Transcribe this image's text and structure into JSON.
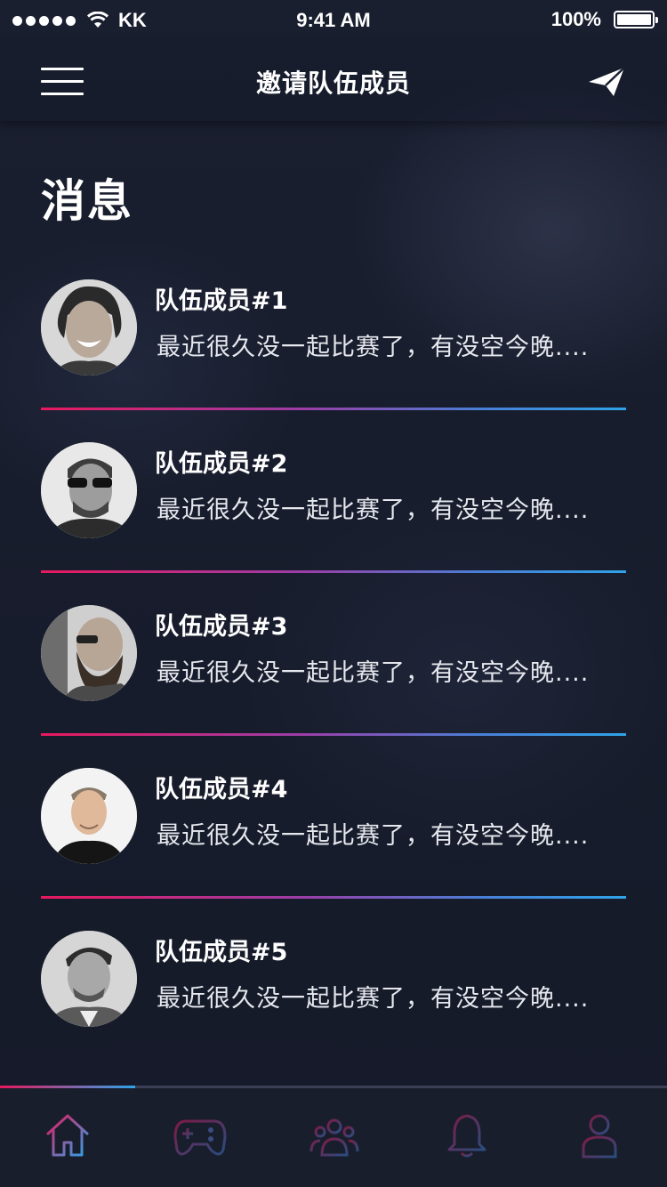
{
  "status_bar": {
    "carrier": "KK",
    "time": "9:41 AM",
    "battery": "100%"
  },
  "header": {
    "title": "邀请队伍成员",
    "menu_icon": "hamburger-menu-icon",
    "send_icon": "paper-plane-icon"
  },
  "page": {
    "title": "消息"
  },
  "messages": [
    {
      "name": "队伍成员#1",
      "preview": "最近很久没一起比赛了，有没空今晚...."
    },
    {
      "name": "队伍成员#2",
      "preview": "最近很久没一起比赛了，有没空今晚...."
    },
    {
      "name": "队伍成员#3",
      "preview": "最近很久没一起比赛了，有没空今晚...."
    },
    {
      "name": "队伍成员#4",
      "preview": "最近很久没一起比赛了，有没空今晚...."
    },
    {
      "name": "队伍成员#5",
      "preview": "最近很久没一起比赛了，有没空今晚...."
    }
  ],
  "tab_bar": {
    "tabs": [
      {
        "icon": "home-icon",
        "active": true
      },
      {
        "icon": "gamepad-icon",
        "active": false
      },
      {
        "icon": "team-icon",
        "active": false
      },
      {
        "icon": "bell-icon",
        "active": false
      },
      {
        "icon": "user-icon",
        "active": false
      }
    ]
  },
  "colors": {
    "gradient_start": "#e8195e",
    "gradient_end": "#2fa3e8",
    "background": "#161b2b"
  }
}
